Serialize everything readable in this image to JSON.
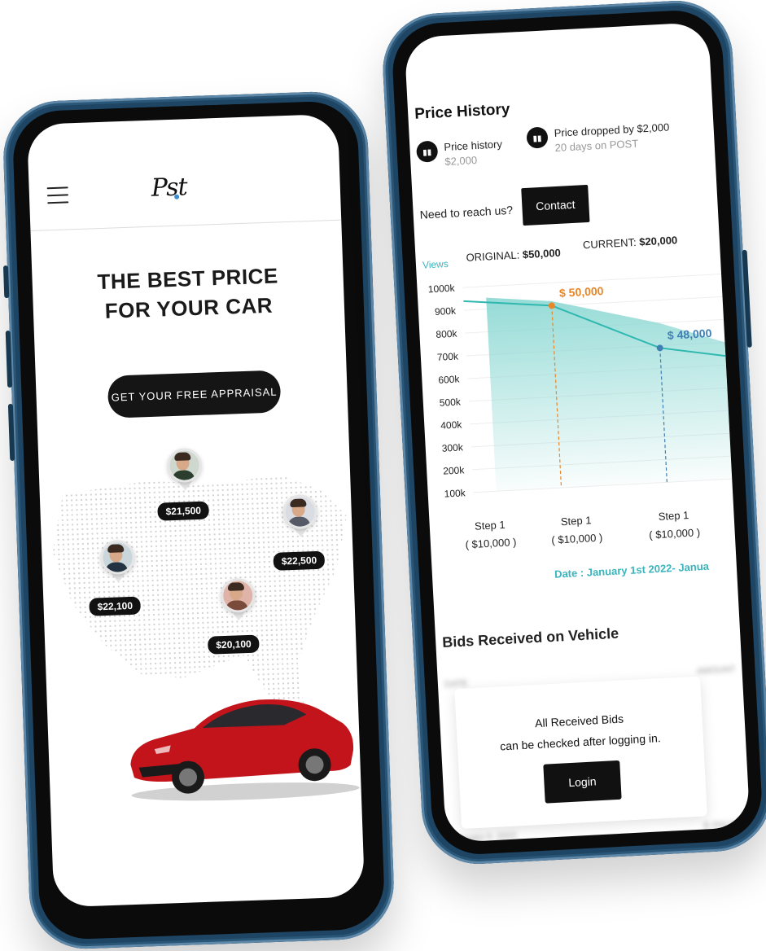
{
  "left_screen": {
    "logo_text": "Pst",
    "hero_line1": "THE BEST PRICE",
    "hero_line2": "FOR YOUR CAR",
    "cta_label": "GET YOUR FREE APPRAISAL",
    "prices": [
      "$21,500",
      "$22,500",
      "$22,100",
      "$20,100"
    ]
  },
  "right_screen": {
    "title": "Price History",
    "stat1": {
      "label": "Price history",
      "value": "$2,000"
    },
    "stat2": {
      "label": "Price dropped by $2,000",
      "value": "20 days on POST"
    },
    "reach_text": "Need to reach us?",
    "contact_label": "Contact",
    "views_label": "Views",
    "original_label": "ORIGINAL:",
    "original_value": "$50,000",
    "current_label": "CURRENT:",
    "current_value": "$20,000",
    "date_range": "Date : January 1st 2022- Janua",
    "bids_title": "Bids Received on Vehicle",
    "table_headers": [
      "DATE",
      "AMOUNT"
    ],
    "table_rows": [
      [
        "January 5, 2022",
        "$ 254,000"
      ]
    ],
    "login_msg_line1": "All Received Bids",
    "login_msg_line2": "can be checked after logging in.",
    "login_label": "Login"
  },
  "chart_data": {
    "type": "area",
    "ylabel": "Views",
    "y_ticks": [
      "1000k",
      "900k",
      "800k",
      "700k",
      "600k",
      "500k",
      "400k",
      "300k",
      "200k",
      "100k"
    ],
    "ylim": [
      100,
      1000
    ],
    "categories": [
      "Step 1",
      "Step 1",
      "Step 1"
    ],
    "category_sub": [
      "( $10,000 )",
      "( $10,000 )",
      "( $10,000 )"
    ],
    "series": [
      {
        "values": [
          940,
          900,
          690,
          640
        ]
      }
    ],
    "area_values": [
      950,
      920,
      800,
      700
    ],
    "annotations": [
      {
        "label": "$ 50,000",
        "color": "#e8862a",
        "point_index": 1
      },
      {
        "label": "$ 48,000",
        "color": "#3f7fb4",
        "point_index": 2
      }
    ],
    "colors": {
      "line": "#2fb8b0",
      "area": "#8fd9d4"
    }
  }
}
